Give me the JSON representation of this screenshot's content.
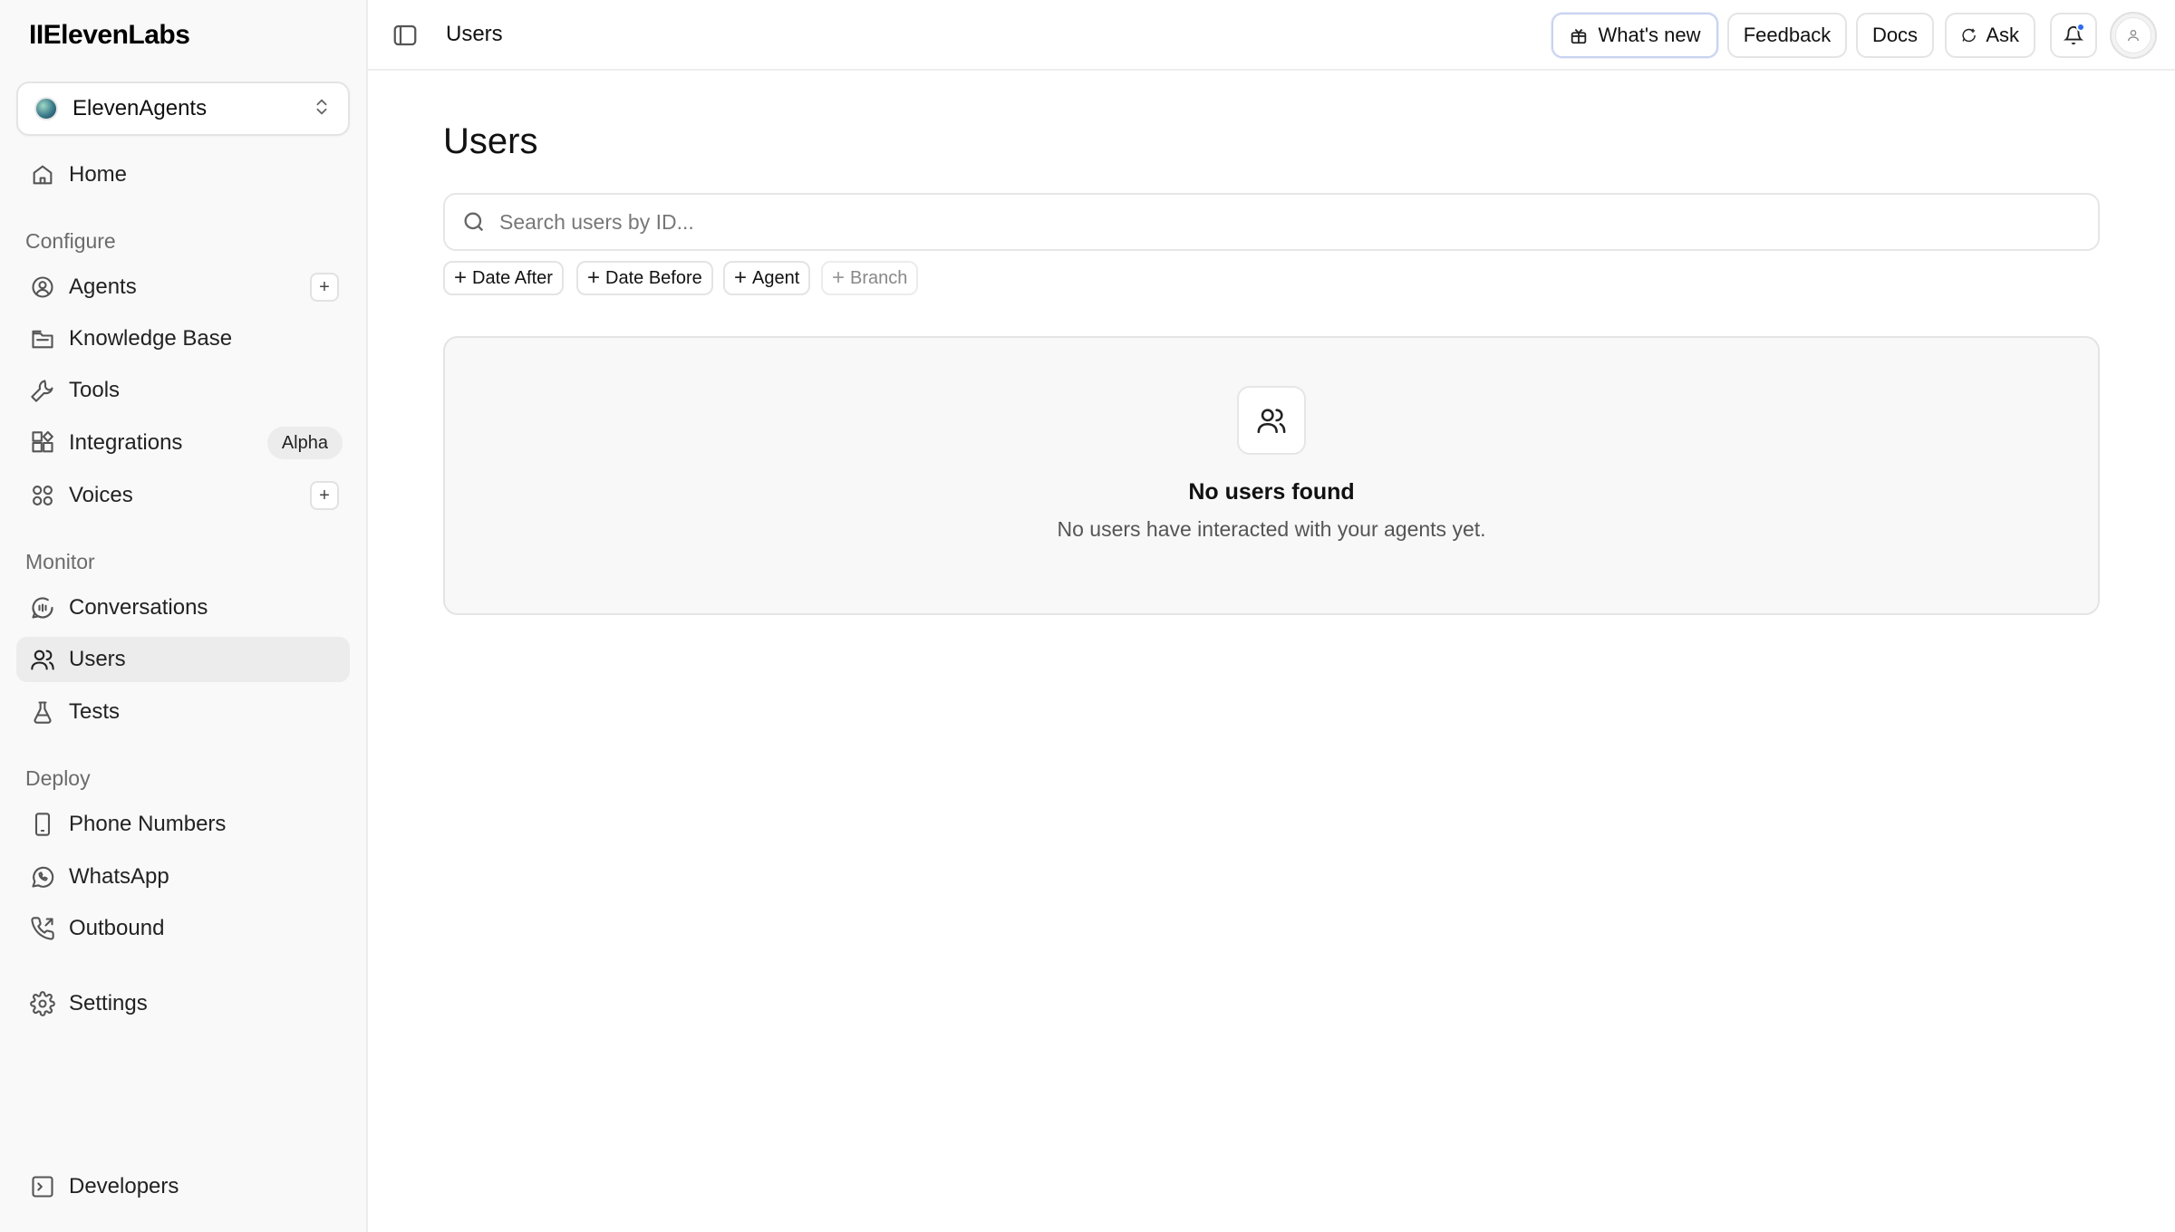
{
  "app": {
    "logo": "IIElevenLabs"
  },
  "workspace": {
    "name": "ElevenAgents"
  },
  "sidebar": {
    "home": "Home",
    "sections": {
      "configure": "Configure",
      "monitor": "Monitor",
      "deploy": "Deploy"
    },
    "configure_items": [
      "Agents",
      "Knowledge Base",
      "Tools",
      "Integrations",
      "Voices"
    ],
    "integrations_badge": "Alpha",
    "monitor_items": [
      "Conversations",
      "Users",
      "Tests"
    ],
    "deploy_items": [
      "Phone Numbers",
      "WhatsApp",
      "Outbound"
    ],
    "settings": "Settings",
    "developers": "Developers",
    "plus": "+"
  },
  "header": {
    "title": "Users",
    "buttons": {
      "whats_new": "What's new",
      "feedback": "Feedback",
      "docs": "Docs",
      "ask": "Ask"
    }
  },
  "main": {
    "title": "Users",
    "search_placeholder": "Search users by ID...",
    "filters": [
      "Date After",
      "Date Before",
      "Agent",
      "Branch"
    ],
    "empty": {
      "title": "No users found",
      "subtitle": "No users have interacted with your agents yet."
    }
  }
}
